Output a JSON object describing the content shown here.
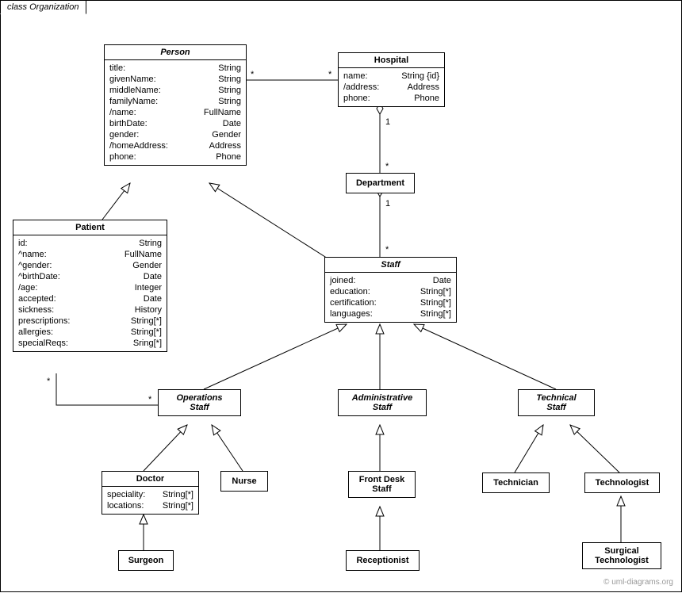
{
  "frame_title": "class Organization",
  "credit": "© uml-diagrams.org",
  "classes": {
    "person": {
      "name": "Person",
      "attrs": [
        [
          "title:",
          "String"
        ],
        [
          "givenName:",
          "String"
        ],
        [
          "middleName:",
          "String"
        ],
        [
          "familyName:",
          "String"
        ],
        [
          "/name:",
          "FullName"
        ],
        [
          "birthDate:",
          "Date"
        ],
        [
          "gender:",
          "Gender"
        ],
        [
          "/homeAddress:",
          "Address"
        ],
        [
          "phone:",
          "Phone"
        ]
      ]
    },
    "hospital": {
      "name": "Hospital",
      "attrs": [
        [
          "name:",
          "String {id}"
        ],
        [
          "/address:",
          "Address"
        ],
        [
          "phone:",
          "Phone"
        ]
      ]
    },
    "department": {
      "name": "Department"
    },
    "patient": {
      "name": "Patient",
      "attrs": [
        [
          "id:",
          "String"
        ],
        [
          "^name:",
          "FullName"
        ],
        [
          "^gender:",
          "Gender"
        ],
        [
          "^birthDate:",
          "Date"
        ],
        [
          "/age:",
          "Integer"
        ],
        [
          "accepted:",
          "Date"
        ],
        [
          "sickness:",
          "History"
        ],
        [
          "prescriptions:",
          "String[*]"
        ],
        [
          "allergies:",
          "String[*]"
        ],
        [
          "specialReqs:",
          "Sring[*]"
        ]
      ]
    },
    "staff": {
      "name": "Staff",
      "attrs": [
        [
          "joined:",
          "Date"
        ],
        [
          "education:",
          "String[*]"
        ],
        [
          "certification:",
          "String[*]"
        ],
        [
          "languages:",
          "String[*]"
        ]
      ]
    },
    "ops": {
      "name": "Operations",
      "name2": "Staff"
    },
    "admin": {
      "name": "Administrative",
      "name2": "Staff"
    },
    "tech": {
      "name": "Technical",
      "name2": "Staff"
    },
    "doctor": {
      "name": "Doctor",
      "attrs": [
        [
          "speciality:",
          "String[*]"
        ],
        [
          "locations:",
          "String[*]"
        ]
      ]
    },
    "nurse": {
      "name": "Nurse"
    },
    "frontdesk": {
      "name": "Front Desk",
      "name2": "Staff"
    },
    "receptionist": {
      "name": "Receptionist"
    },
    "technician": {
      "name": "Technician"
    },
    "technologist": {
      "name": "Technologist"
    },
    "surgtech": {
      "name": "Surgical",
      "name2": "Technologist"
    },
    "surgeon": {
      "name": "Surgeon"
    }
  },
  "mult": {
    "star": "*",
    "one": "1"
  }
}
